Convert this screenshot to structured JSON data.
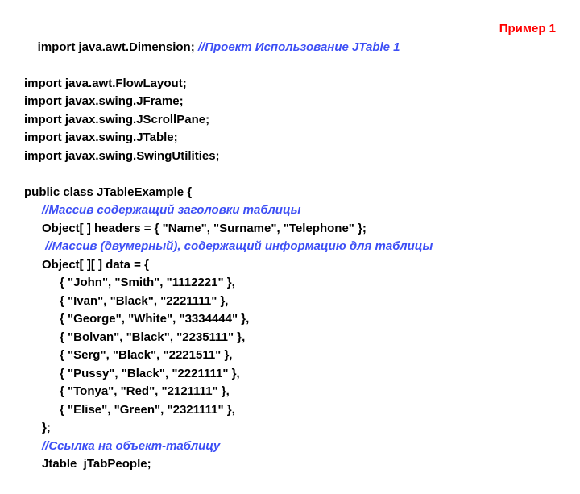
{
  "header": {
    "import1_code": "import java.awt.Dimension; ",
    "import1_comment": "//Проект Использование JTable 1",
    "example_label": "Пример 1"
  },
  "imports": [
    "import java.awt.FlowLayout;",
    "import javax.swing.JFrame;",
    "import javax.swing.JScrollPane;",
    "import javax.swing.JTable;",
    "import javax.swing.SwingUtilities;"
  ],
  "blank1": " ",
  "class_decl": "public class JTableExample {",
  "comment_headers": "//Массив содержащий заголовки таблицы",
  "headers_line": "Object[ ] headers = { \"Name\", \"Surname\", \"Telephone\" };",
  "comment_data": " //Массив (двумерный), содержащий информацию для таблицы",
  "data_open": "Object[ ][ ] data = {",
  "data_rows": [
    "{ \"John\", \"Smith\", \"1112221\" },",
    "{ \"Ivan\", \"Black\", \"2221111\" },",
    "{ \"George\", \"White\", \"3334444\" },",
    "{ \"Bolvan\", \"Black\", \"2235111\" },",
    "{ \"Serg\", \"Black\", \"2221511\" },",
    "{ \"Pussy\", \"Black\", \"2221111\" },",
    "{ \"Tonya\", \"Red\", \"2121111\" },",
    "{ \"Elise\", \"Green\", \"2321111\" },"
  ],
  "data_close": "};",
  "comment_ref": "//Ссылка на объект-таблицу",
  "ref_line": "Jtable  jTabPeople;"
}
